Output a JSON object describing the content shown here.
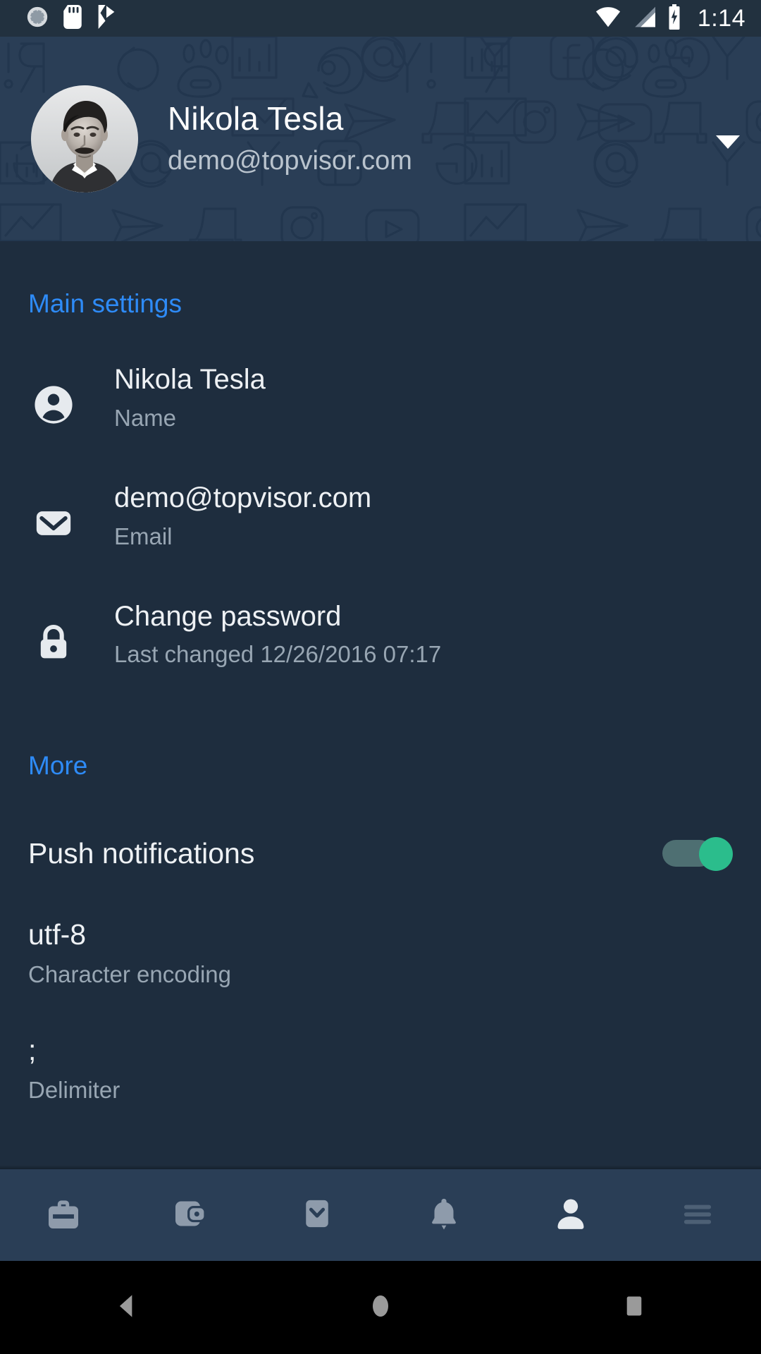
{
  "statusbar": {
    "time": "1:14",
    "left_icons": [
      "alarm-ring-icon",
      "sd-card-icon",
      "checkmark-flag-icon"
    ],
    "right_icons": [
      "wifi-icon",
      "cell-signal-icon",
      "battery-charging-icon"
    ]
  },
  "header": {
    "name": "Nikola Tesla",
    "email": "demo@topvisor.com",
    "avatar_alt": "Nikola Tesla portrait",
    "dropdown_icon": "chevron-down-icon",
    "background_color": "#2a3e56"
  },
  "sections": {
    "main": {
      "title": "Main settings",
      "title_color": "#2e8bf7",
      "rows": [
        {
          "icon": "person-icon",
          "value": "Nikola Tesla",
          "label": "Name"
        },
        {
          "icon": "mail-icon",
          "value": "demo@topvisor.com",
          "label": "Email"
        },
        {
          "icon": "lock-icon",
          "value": "Change password",
          "label": "Last changed 12/26/2016 07:17"
        }
      ]
    },
    "more": {
      "title": "More",
      "title_color": "#2e8bf7",
      "rows": [
        {
          "value": "Push notifications",
          "label": "",
          "control": "toggle",
          "toggle_on": true,
          "toggle_color": "#2bbd8c"
        },
        {
          "value": "utf-8",
          "label": "Character encoding"
        },
        {
          "value": ";",
          "label": "Delimiter"
        }
      ]
    }
  },
  "bottomnav": {
    "items": [
      {
        "icon": "briefcase-icon",
        "active": false
      },
      {
        "icon": "wallet-icon",
        "active": false
      },
      {
        "icon": "mail-icon",
        "active": false
      },
      {
        "icon": "bell-icon",
        "active": false
      },
      {
        "icon": "person-icon",
        "active": true
      },
      {
        "icon": "hamburger-menu-icon",
        "active": false
      }
    ],
    "active_color": "#e6eaee",
    "inactive_color": "#4d6075"
  },
  "sysnav": {
    "items": [
      "back-icon",
      "home-icon",
      "recents-icon"
    ],
    "color": "#9a9a9a"
  }
}
